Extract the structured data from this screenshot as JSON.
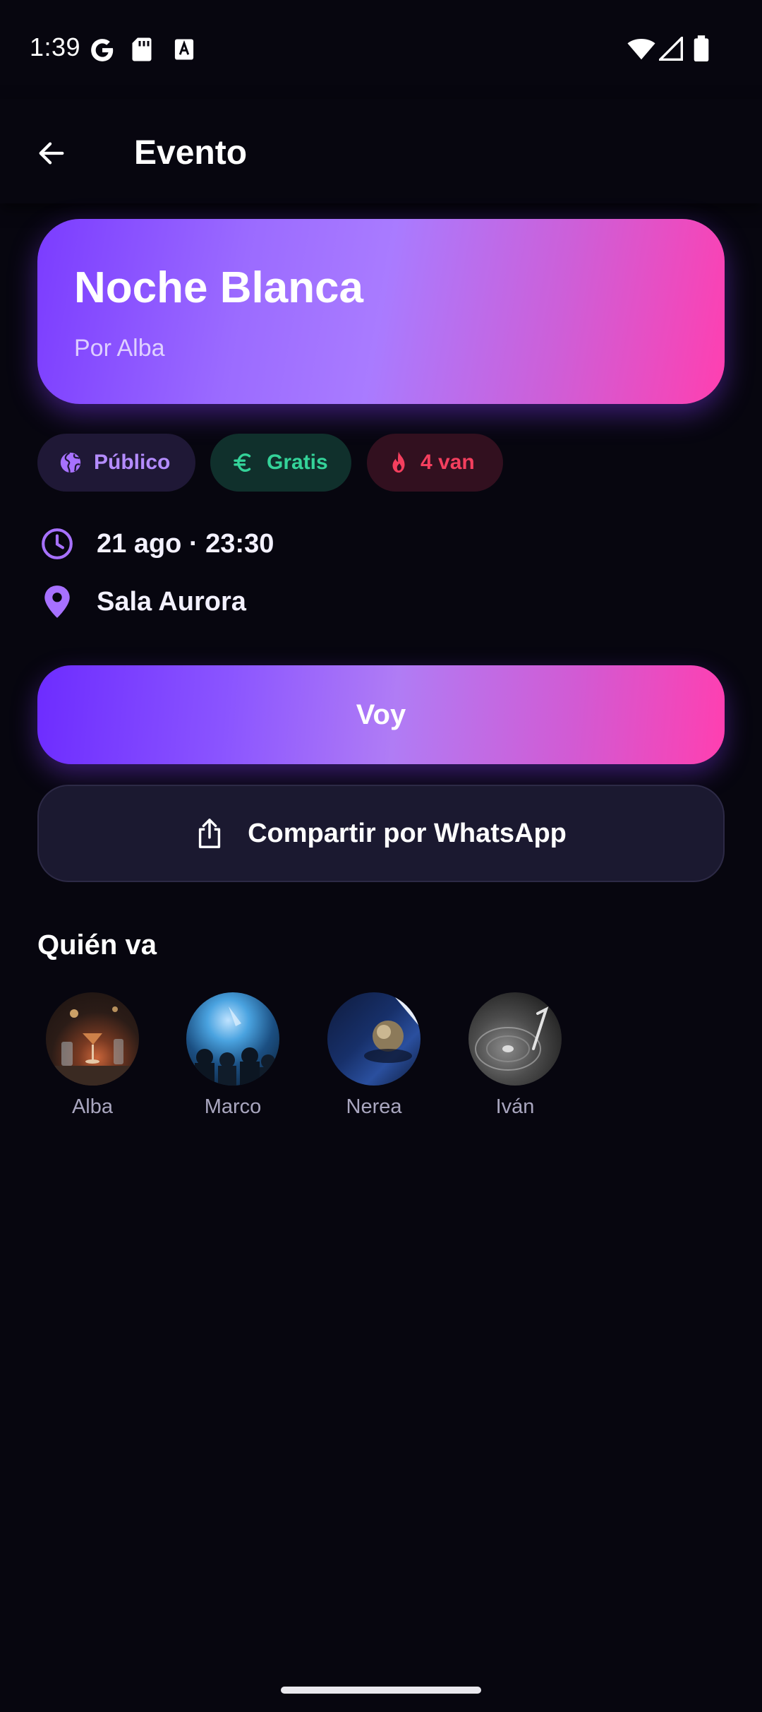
{
  "status_bar": {
    "time": "1:39",
    "left_icons": [
      "google-icon",
      "sd-card-icon",
      "font-a-icon"
    ],
    "right_icons": [
      "wifi-icon",
      "signal-icon",
      "battery-icon"
    ]
  },
  "app_bar": {
    "back_icon": "arrow-back-icon",
    "title": "Evento"
  },
  "event": {
    "title": "Noche Blanca",
    "organizer": "Por Alba",
    "chips": [
      {
        "label": "Público",
        "icon": "globe-icon",
        "color": "#b48cff"
      },
      {
        "label": "Gratis",
        "icon": "euro-icon",
        "color": "#34d399"
      },
      {
        "label": "4 van",
        "icon": "flame-icon",
        "color": "#f43f5e"
      }
    ],
    "datetime": "21 ago · 23:30",
    "location": "Sala Aurora"
  },
  "actions": {
    "going_label": "Voy",
    "share_label": "Compartir por WhatsApp",
    "share_icon": "share-icon"
  },
  "attendees": {
    "title": "Quién va",
    "people": [
      {
        "name": "Alba"
      },
      {
        "name": "Marco"
      },
      {
        "name": "Nerea"
      },
      {
        "name": "Iván"
      }
    ]
  },
  "colors": {
    "background": "#07060f",
    "accent_purple": "#7b3cff",
    "accent_pink": "#ff3fb0",
    "icon_purple": "#a771ff"
  }
}
